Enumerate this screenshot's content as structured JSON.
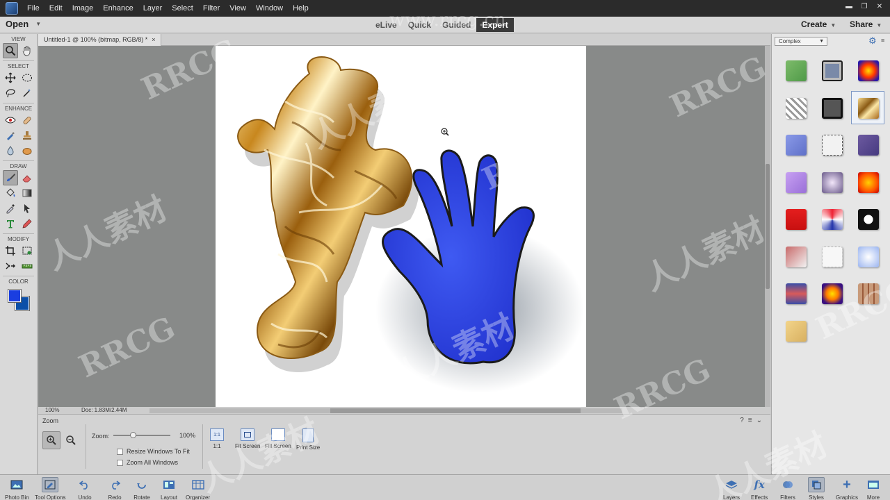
{
  "menubar": {
    "items": [
      "File",
      "Edit",
      "Image",
      "Enhance",
      "Layer",
      "Select",
      "Filter",
      "View",
      "Window",
      "Help"
    ]
  },
  "modebar": {
    "open_label": "Open",
    "tabs": [
      {
        "label": "eLive",
        "active": false
      },
      {
        "label": "Quick",
        "active": false
      },
      {
        "label": "Guided",
        "active": false
      },
      {
        "label": "Expert",
        "active": true
      }
    ],
    "create_label": "Create",
    "share_label": "Share"
  },
  "toolbox": {
    "sections": [
      "VIEW",
      "SELECT",
      "ENHANCE",
      "DRAW",
      "MODIFY",
      "COLOR"
    ],
    "foreground_color": "#1a3ee0",
    "background_color": "#0b4fa8"
  },
  "document": {
    "tab_title": "Untitled-1 @ 100% (bitmap, RGB/8) *",
    "tab_close": "×",
    "zoom_status": "100%",
    "doc_size": "Doc: 1.83M/2.44M",
    "hand_color": "#2f48e6"
  },
  "tool_options": {
    "title": "Zoom",
    "zoom_label": "Zoom:",
    "zoom_value": "100%",
    "zoom_level": 1.0,
    "resize_windows_label": "Resize Windows To Fit",
    "zoom_all_label": "Zoom All Windows",
    "view_buttons": [
      {
        "label": "1:1",
        "icon_text": "1:1"
      },
      {
        "label": "Fit Screen",
        "icon_text": ""
      },
      {
        "label": "Fill Screen",
        "icon_text": ""
      },
      {
        "label": "Print Size",
        "icon_text": ""
      }
    ]
  },
  "taskbar": {
    "left": [
      "Photo Bin",
      "Tool Options",
      "Undo",
      "Redo",
      "Rotate",
      "Layout",
      "Organizer"
    ],
    "right": [
      "Layers",
      "Effects",
      "Filters",
      "Styles",
      "Graphics",
      "More"
    ]
  },
  "styles_panel": {
    "category": "Complex"
  },
  "watermarks": {
    "latin": "RRCG",
    "chinese": "人人素材",
    "url": "www.rrcg.cn"
  }
}
